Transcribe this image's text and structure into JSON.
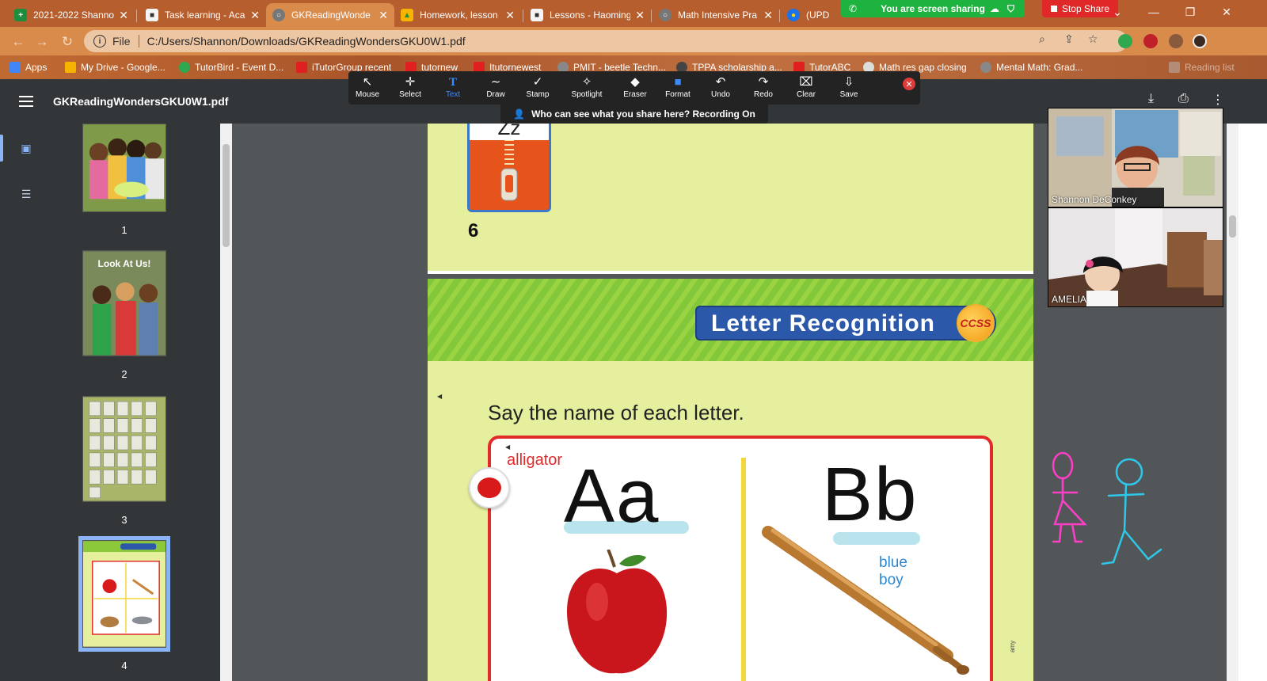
{
  "tabs": [
    {
      "title": "2021-2022 Shanno",
      "favicon_color": "#1e8e3e",
      "favicon_glyph": "+"
    },
    {
      "title": "Task learning - Aca",
      "favicon_color": "#f5f5f5",
      "favicon_glyph": "■"
    },
    {
      "title": "GKReadingWonde",
      "favicon_color": "#777777",
      "favicon_glyph": "○"
    },
    {
      "title": "Homework, lesson",
      "favicon_color": "#f4b400",
      "favicon_glyph": "▲"
    },
    {
      "title": "Lessons - Haoming",
      "favicon_color": "#f5f5f5",
      "favicon_glyph": "■"
    },
    {
      "title": "Math Intensive Pra",
      "favicon_color": "#777777",
      "favicon_glyph": "○"
    },
    {
      "title": "(UPD",
      "favicon_color": "#1a73e8",
      "favicon_glyph": "●"
    }
  ],
  "active_tab_index": 2,
  "share_banner": {
    "text": "You are screen sharing",
    "stop_label": "Stop Share"
  },
  "address_bar": {
    "scheme_label": "File",
    "url": "C:/Users/Shannon/Downloads/GKReadingWondersGKU0W1.pdf"
  },
  "bookmarks": [
    {
      "label": "Apps",
      "color": "#4285f4"
    },
    {
      "label": "My Drive - Google...",
      "color": "#f4b400"
    },
    {
      "label": "TutorBird - Event D...",
      "color": "#2fa84f"
    },
    {
      "label": "iTutorGroup recent",
      "color": "#e02020"
    },
    {
      "label": "tutornew",
      "color": "#e02020"
    },
    {
      "label": "Itutornewest",
      "color": "#e02020"
    },
    {
      "label": "PMIT - beetle Techn...",
      "color": "#888888"
    },
    {
      "label": "TPPA scholarship a...",
      "color": "#444444"
    },
    {
      "label": "TutorABC",
      "color": "#e02020"
    },
    {
      "label": "Math res gap closing",
      "color": "#dddddd"
    },
    {
      "label": "Mental Math: Grad...",
      "color": "#888888"
    },
    {
      "label": "Reading list",
      "color": "#bbbbbb"
    }
  ],
  "annotation_tools": [
    {
      "label": "Mouse",
      "glyph": "↖"
    },
    {
      "label": "Select",
      "glyph": "✛"
    },
    {
      "label": "Text",
      "glyph": "T"
    },
    {
      "label": "Draw",
      "glyph": "∼"
    },
    {
      "label": "Stamp",
      "glyph": "✓"
    },
    {
      "label": "Spotlight",
      "glyph": "✧"
    },
    {
      "label": "Eraser",
      "glyph": "◆"
    },
    {
      "label": "Format",
      "glyph": "■"
    },
    {
      "label": "Undo",
      "glyph": "↶"
    },
    {
      "label": "Redo",
      "glyph": "↷"
    },
    {
      "label": "Clear",
      "glyph": "⌧"
    },
    {
      "label": "Save",
      "glyph": "⇩"
    }
  ],
  "selected_tool": "Text",
  "share_notice": "Who can see what you share here? Recording On",
  "pdf": {
    "title": "GKReadingWondersGKU0W1.pdf",
    "thumbnails": [
      {
        "page": "1",
        "mini_title": ""
      },
      {
        "page": "2",
        "mini_title": "Look At Us!"
      },
      {
        "page": "3",
        "mini_title": ""
      },
      {
        "page": "4",
        "mini_title": ""
      }
    ],
    "selected_thumbnail": "4",
    "prev_page": {
      "card_letter": "Zz",
      "page_number": "6"
    },
    "page": {
      "banner_title": "Letter Recognition",
      "badge": "CCSS",
      "instruction": "Say the name of each letter.",
      "word_left": "alligator",
      "letter_left": "Aa",
      "letter_right": "Bb",
      "words_right": [
        "blue",
        "boy"
      ],
      "footer_text": "amy"
    }
  },
  "participants": [
    {
      "name": "Shannon DeConkey"
    },
    {
      "name": "AMELIA"
    }
  ],
  "doodle_colors": {
    "pink": "#ff3ec8",
    "cyan": "#2ec8e8"
  }
}
